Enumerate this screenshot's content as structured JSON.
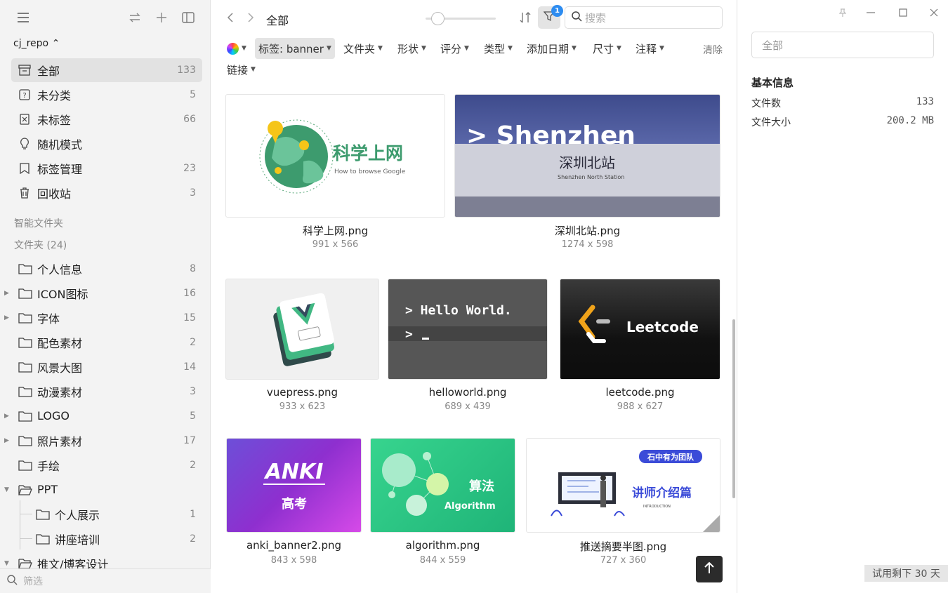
{
  "sidebar": {
    "repo": "cj_repo",
    "nav": [
      {
        "label": "全部",
        "count": "133",
        "icon": "archive-icon"
      },
      {
        "label": "未分类",
        "count": "5",
        "icon": "question-box-icon"
      },
      {
        "label": "未标签",
        "count": "66",
        "icon": "untagged-icon"
      },
      {
        "label": "随机模式",
        "count": "",
        "icon": "lightbulb-icon"
      },
      {
        "label": "标签管理",
        "count": "23",
        "icon": "bookmark-icon"
      },
      {
        "label": "回收站",
        "count": "3",
        "icon": "trash-icon"
      }
    ],
    "smart_folders": "智能文件夹",
    "folders_header": "文件夹 (24)",
    "folders": [
      {
        "label": "个人信息",
        "count": "8"
      },
      {
        "label": "ICON图标",
        "count": "16"
      },
      {
        "label": "字体",
        "count": "15"
      },
      {
        "label": "配色素材",
        "count": "2"
      },
      {
        "label": "风景大图",
        "count": "14"
      },
      {
        "label": "动漫素材",
        "count": "3"
      },
      {
        "label": "LOGO",
        "count": "5"
      },
      {
        "label": "照片素材",
        "count": "17"
      },
      {
        "label": "手绘",
        "count": "2"
      },
      {
        "label": "PPT",
        "count": ""
      },
      {
        "label": "个人展示",
        "count": "1"
      },
      {
        "label": "讲座培训",
        "count": "2"
      },
      {
        "label": "推文/博客设计",
        "count": ""
      }
    ],
    "filter_placeholder": "筛选"
  },
  "main": {
    "breadcrumb": "全部",
    "search_placeholder": "搜索",
    "filter_badge": "1",
    "filters": {
      "tag": "标签: banner",
      "folder": "文件夹",
      "shape": "形状",
      "rating": "评分",
      "type": "类型",
      "date": "添加日期",
      "size": "尺寸",
      "note": "注释",
      "link": "链接",
      "clear": "清除"
    },
    "items": [
      {
        "name": "科学上网.png",
        "size": "991 x 566",
        "thumb_title": "科学上网",
        "thumb_sub": "How to browse Google"
      },
      {
        "name": "深圳北站.png",
        "size": "1274 x 598",
        "thumb_title": "> Shenzhen",
        "thumb_sub": "深圳北站",
        "thumb_sub2": "Shenzhen North Station"
      },
      {
        "name": "vuepress.png",
        "size": "933 x 623"
      },
      {
        "name": "helloworld.png",
        "size": "689 x 439",
        "thumb_title": "> Hello World.",
        "thumb_sub": ">"
      },
      {
        "name": "leetcode.png",
        "size": "988 x 627",
        "thumb_title": "Leetcode"
      },
      {
        "name": "anki_banner2.png",
        "size": "843 x 598",
        "thumb_title": "ANKI",
        "thumb_sub": "高考"
      },
      {
        "name": "algorithm.png",
        "size": "844 x 559",
        "thumb_title": "算法",
        "thumb_sub": "Algorithm"
      },
      {
        "name": "推送摘要半图.png",
        "size": "727 x 360",
        "thumb_title": "讲师介绍篇",
        "thumb_sub": "石中有为团队",
        "thumb_sub2": "INTRODUCTION"
      }
    ]
  },
  "panel": {
    "name_placeholder": "全部",
    "section_title": "基本信息",
    "rows": [
      {
        "label": "文件数",
        "value": "133"
      },
      {
        "label": "文件大小",
        "value": "200.2 MB"
      }
    ],
    "trial": "试用剩下 30 天"
  }
}
